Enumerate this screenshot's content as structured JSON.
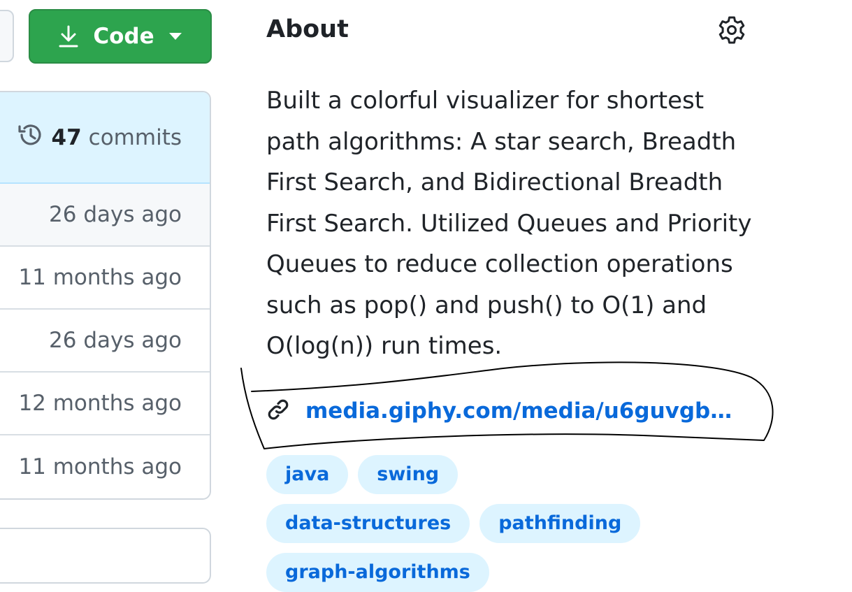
{
  "toolbar": {
    "code_label": "Code"
  },
  "files": {
    "commit_count": "47",
    "commit_unit": "commits",
    "rows": [
      "26 days ago",
      "11 months ago",
      "26 days ago",
      "12 months ago",
      "11 months ago"
    ]
  },
  "about": {
    "title": "About",
    "description": "Built a colorful visualizer for shortest path algorithms: A star search, Breadth First Search, and Bidirectional Breadth First Search. Utilized Queues and Priority Queues to reduce collection operations such as pop() and push() to O(1) and O(log(n)) run times.",
    "link": "media.giphy.com/media/u6guvgboqo…",
    "topics": [
      "java",
      "swing",
      "data-structures",
      "pathfinding",
      "graph-algorithms"
    ]
  },
  "colors": {
    "accent_green": "#2da44e",
    "link_blue": "#0969da",
    "topic_bg": "#ddf4ff"
  },
  "icons": [
    "download-icon",
    "caret-down-icon",
    "history-icon",
    "gear-icon",
    "link-icon"
  ]
}
